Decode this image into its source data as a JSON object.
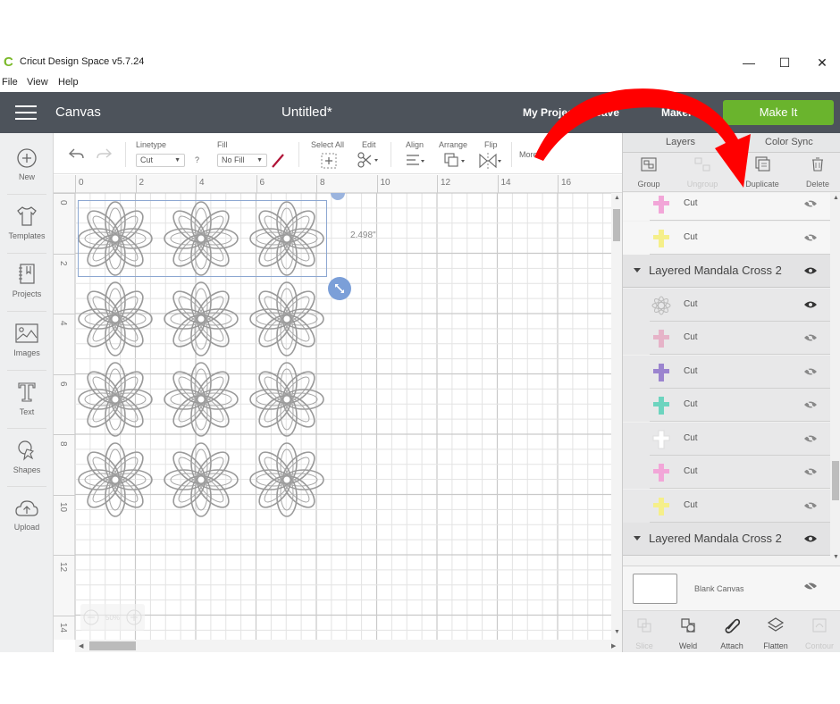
{
  "window": {
    "app_title": "Cricut Design Space  v5.7.24",
    "controls": {
      "minimize": "—",
      "maximize": "☐",
      "close": "✕"
    }
  },
  "menubar": [
    "File",
    "View",
    "Help"
  ],
  "header": {
    "section": "Canvas",
    "document_title": "Untitled*",
    "my_projects": "My Projects",
    "save": "Save",
    "machine": "Maker",
    "make_it": "Make It"
  },
  "left_sidebar": [
    {
      "label": "New",
      "icon": "plus-circle-icon"
    },
    {
      "label": "Templates",
      "icon": "tshirt-icon"
    },
    {
      "label": "Projects",
      "icon": "notebook-icon"
    },
    {
      "label": "Images",
      "icon": "image-icon"
    },
    {
      "label": "Text",
      "icon": "text-t-icon"
    },
    {
      "label": "Shapes",
      "icon": "shapes-icon"
    },
    {
      "label": "Upload",
      "icon": "cloud-upload-icon"
    }
  ],
  "toolbar": {
    "undo_icon": "undo-icon",
    "redo_icon": "redo-icon",
    "linetype_label": "Linetype",
    "linetype_value": "Cut",
    "help": "?",
    "fill_label": "Fill",
    "fill_value": "No Fill",
    "select_all": "Select All",
    "edit": "Edit",
    "align": "Align",
    "arrange": "Arrange",
    "flip": "Flip",
    "more": "More ▾"
  },
  "ruler": {
    "top_ticks": [
      "0",
      "2",
      "4",
      "6",
      "8",
      "10",
      "12",
      "14",
      "16"
    ],
    "left_ticks": [
      "0",
      "2",
      "4",
      "6",
      "8",
      "10",
      "12",
      "14"
    ],
    "units": "inches"
  },
  "canvas": {
    "selection_height_label": "2.498\"",
    "grid_rows": 4,
    "grid_cols": 3,
    "design": "Layered Mandala Cross 2 (mandala layer)"
  },
  "right_panel": {
    "tabs": [
      "Layers",
      "Color Sync"
    ],
    "actions": [
      {
        "label": "Group",
        "enabled": true,
        "icon": "group-icon"
      },
      {
        "label": "Ungroup",
        "enabled": false,
        "icon": "ungroup-icon"
      },
      {
        "label": "Duplicate",
        "enabled": true,
        "icon": "duplicate-icon"
      },
      {
        "label": "Delete",
        "enabled": true,
        "icon": "trash-icon"
      }
    ],
    "layers": [
      {
        "type": "layer",
        "name": "Cut",
        "color": "#f2a6d8",
        "shape": "cross",
        "visible": false
      },
      {
        "type": "layer",
        "name": "Cut",
        "color": "#f5ef8a",
        "shape": "cross",
        "visible": false
      },
      {
        "type": "group",
        "name": "Layered Mandala Cross 2",
        "visible": true
      },
      {
        "type": "layer",
        "name": "Cut",
        "color": "#cfcfcf",
        "shape": "mandala",
        "visible": true
      },
      {
        "type": "layer",
        "name": "Cut",
        "color": "#e6b3c8",
        "shape": "cross",
        "visible": false
      },
      {
        "type": "layer",
        "name": "Cut",
        "color": "#9b84cf",
        "shape": "cross",
        "visible": false
      },
      {
        "type": "layer",
        "name": "Cut",
        "color": "#6dd4bf",
        "shape": "cross",
        "visible": false
      },
      {
        "type": "layer",
        "name": "Cut",
        "color": "#ffffff",
        "shape": "cross",
        "visible": false
      },
      {
        "type": "layer",
        "name": "Cut",
        "color": "#f2a6d8",
        "shape": "cross",
        "visible": false
      },
      {
        "type": "layer",
        "name": "Cut",
        "color": "#f5ef8a",
        "shape": "cross",
        "visible": false
      },
      {
        "type": "group",
        "name": "Layered Mandala Cross 2",
        "visible": true
      }
    ],
    "blank_canvas": "Blank Canvas",
    "bottom_actions": [
      {
        "label": "Slice",
        "enabled": false
      },
      {
        "label": "Weld",
        "enabled": true
      },
      {
        "label": "Attach",
        "enabled": true
      },
      {
        "label": "Flatten",
        "enabled": true
      },
      {
        "label": "Contour",
        "enabled": false
      }
    ]
  },
  "colors": {
    "header_bg": "#4d535b",
    "make_it_green": "#6ab42d",
    "selection_blue": "#8ca7d1",
    "annotation_red": "#ff0000"
  },
  "annotation": {
    "type": "red-curved-arrow",
    "points_to": "Duplicate"
  }
}
